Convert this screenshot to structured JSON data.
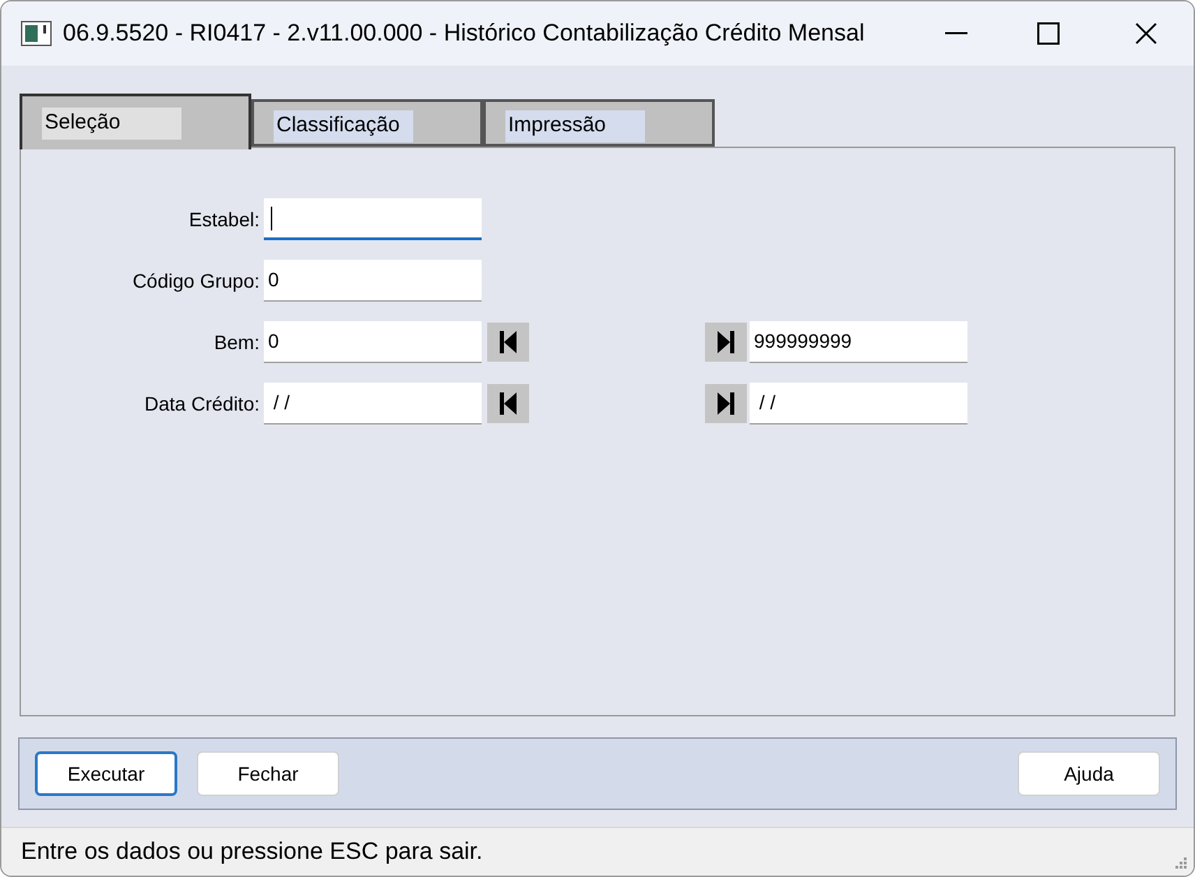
{
  "window": {
    "title": "06.9.5520 - RI0417 - 2.v11.00.000 - Histórico Contabilização Crédito Mensal"
  },
  "tabs": [
    {
      "label": "Seleção",
      "selected": true
    },
    {
      "label": "Classificação",
      "selected": false
    },
    {
      "label": "Impressão",
      "selected": false
    }
  ],
  "fields": [
    {
      "kind": "single",
      "label": "Estabel:",
      "focused": true
    },
    {
      "kind": "single",
      "label": "Código Grupo:",
      "value": "0",
      "focused": false
    },
    {
      "kind": "range",
      "label": "Bem:",
      "from": "0",
      "to": "999999999",
      "focused": false
    },
    {
      "kind": "range",
      "label": "Data Crédito:",
      "from": " / /",
      "to": " / /",
      "focused": false
    }
  ],
  "buttons": [
    {
      "label": "Executar",
      "default": true
    },
    {
      "label": "Fechar",
      "default": false
    }
  ],
  "help_button": {
    "label": "Ajuda"
  },
  "status_bar": "Entre os dados ou pressione ESC para sair."
}
